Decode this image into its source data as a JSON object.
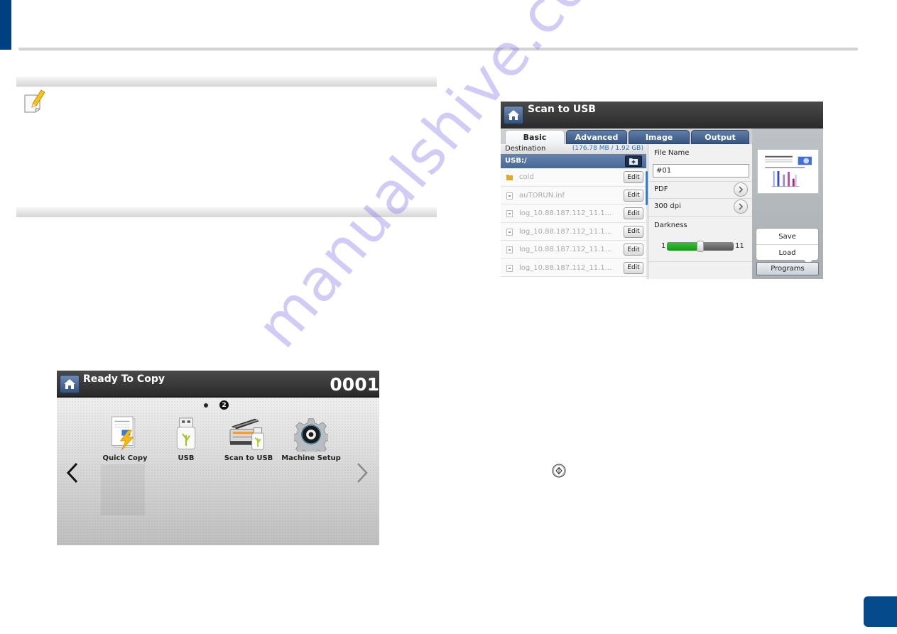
{
  "page": {
    "accent_color": "#003f80",
    "page_badge_color": "#044a8b",
    "watermark": "manualshive.com"
  },
  "copy_screen": {
    "title": "Ready To Copy",
    "copy_count": "0001",
    "page_indicator": {
      "current_page": 2,
      "current_label": "2"
    },
    "apps": [
      {
        "label": "Quick Copy",
        "icon": "quick-copy-icon"
      },
      {
        "label": "USB",
        "icon": "usb-icon"
      },
      {
        "label": "Scan to USB",
        "icon": "scan-to-usb-icon"
      },
      {
        "label": "Machine Setup",
        "icon": "machine-setup-gear-icon"
      }
    ],
    "nav": {
      "prev": "chevron-left-icon",
      "next": "chevron-right-icon"
    }
  },
  "scan_screen": {
    "title": "Scan to USB",
    "tabs": [
      {
        "label": "Basic",
        "active": true
      },
      {
        "label": "Advanced",
        "active": false
      },
      {
        "label": "Image",
        "active": false
      },
      {
        "label": "Output",
        "active": false
      }
    ],
    "destination": {
      "label": "Destination",
      "capacity": "(176.78 MB / 1.92 GB)",
      "path": "USB:/",
      "files": [
        {
          "name": "cold",
          "type": "folder",
          "action": "Edit"
        },
        {
          "name": "auTORUN.inf",
          "type": "file",
          "action": "Edit"
        },
        {
          "name": "log_10.88.187.112_11.1...",
          "type": "file",
          "action": "Edit"
        },
        {
          "name": "log_10.88.187.112_11.1...",
          "type": "file",
          "action": "Edit"
        },
        {
          "name": "log_10.88.187.112_11.1...",
          "type": "file",
          "action": "Edit"
        },
        {
          "name": "log_10.88.187.112_11.1...",
          "type": "file",
          "action": "Edit"
        }
      ]
    },
    "settings": {
      "file_name_label": "File Name",
      "file_name_value": "#01",
      "file_format": "PDF",
      "resolution": "300 dpi",
      "darkness_label": "Darkness",
      "darkness_min": "1",
      "darkness_max": "11",
      "darkness_value": 6
    },
    "programs": {
      "menu": [
        "Save",
        "Load"
      ],
      "button_label": "Programs"
    }
  },
  "start_button_icon": "start-diamond-icon"
}
